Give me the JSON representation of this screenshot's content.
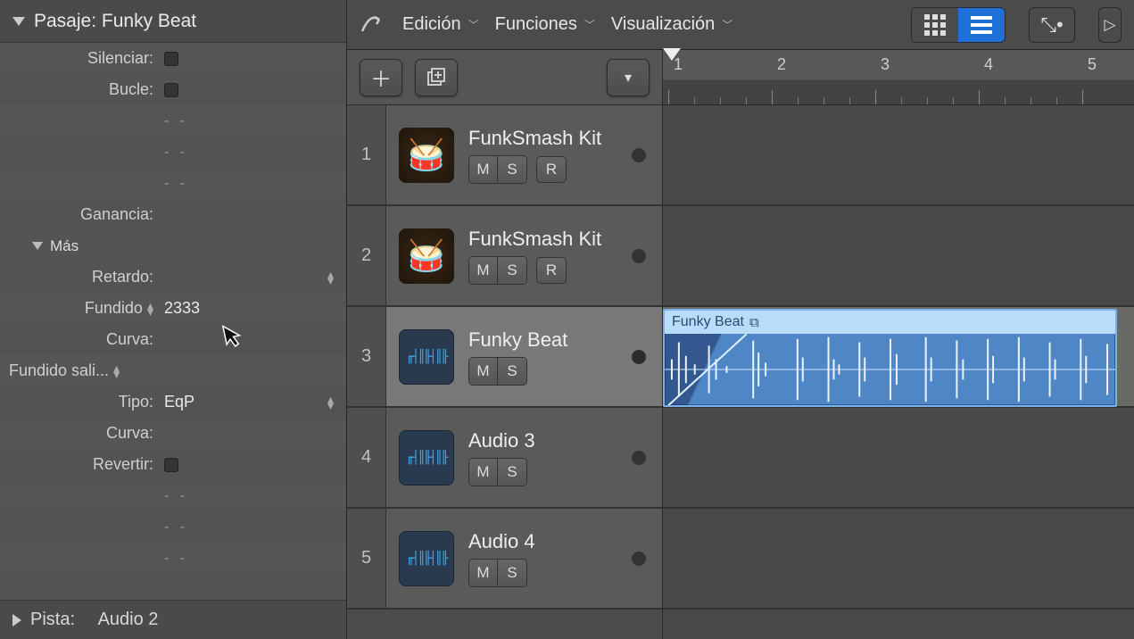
{
  "inspector": {
    "header_prefix": "Pasaje:",
    "header_name": "Funky Beat",
    "rows": {
      "silenciar": "Silenciar:",
      "bucle": "Bucle:",
      "ganancia": "Ganancia:",
      "mas": "Más",
      "retardo": "Retardo:",
      "fundido_lbl": "Fundido",
      "fundido_val": "2333",
      "curva1": "Curva:",
      "fundido_sal": "Fundido sali...",
      "tipo_lbl": "Tipo:",
      "tipo_val": "EqP",
      "curva2": "Curva:",
      "revertir": "Revertir:"
    },
    "footer_prefix": "Pista:",
    "footer_name": "Audio 2",
    "blank": "-  -"
  },
  "menubar": {
    "edicion": "Edición",
    "funciones": "Funciones",
    "visualizacion": "Visualización"
  },
  "ruler": {
    "bars": [
      "1",
      "2",
      "3",
      "4",
      "5"
    ]
  },
  "tracks": [
    {
      "num": "1",
      "name": "FunkSmash Kit",
      "type": "drum",
      "hasR": true,
      "selected": false
    },
    {
      "num": "2",
      "name": "FunkSmash Kit",
      "type": "drum",
      "hasR": true,
      "selected": false
    },
    {
      "num": "3",
      "name": "Funky Beat",
      "type": "audio",
      "hasR": false,
      "selected": true
    },
    {
      "num": "4",
      "name": "Audio 3",
      "type": "audio",
      "hasR": false,
      "selected": false
    },
    {
      "num": "5",
      "name": "Audio 4",
      "type": "audio",
      "hasR": false,
      "selected": false
    }
  ],
  "btns": {
    "M": "M",
    "S": "S",
    "R": "R"
  },
  "region": {
    "name": "Funky Beat"
  }
}
